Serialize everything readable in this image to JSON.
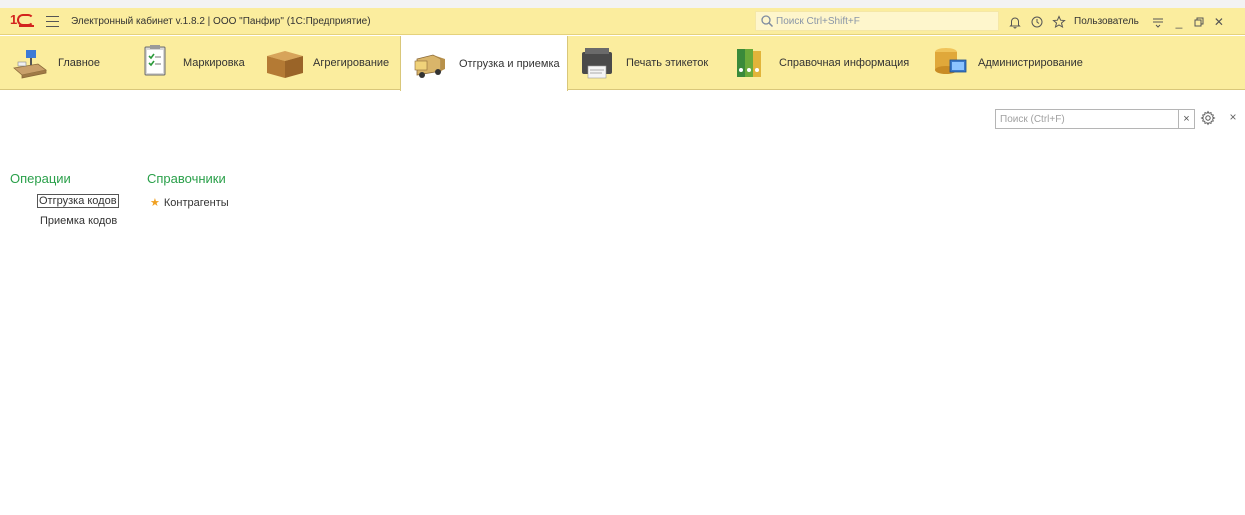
{
  "titlebar": {
    "title": "Электронный кабинет v.1.8.2 | ООО \"Панфир\" (1С:Предприятие)",
    "search_placeholder": "Поиск Ctrl+Shift+F",
    "user": "Пользователь"
  },
  "sections": [
    {
      "label": "Главное",
      "icon": "desk-icon"
    },
    {
      "label": "Маркировка",
      "icon": "checklist-icon"
    },
    {
      "label": "Агрегирование",
      "icon": "box-icon"
    },
    {
      "label": "Отгрузка и приемка",
      "icon": "truck-icon",
      "active": true
    },
    {
      "label": "Печать этикеток",
      "icon": "printer-icon"
    },
    {
      "label": "Справочная информация",
      "icon": "binders-icon"
    },
    {
      "label": "Администрирование",
      "icon": "database-icon"
    }
  ],
  "content": {
    "search_placeholder": "Поиск (Ctrl+F)",
    "clear_label": "×",
    "close_label": "×",
    "operations": {
      "title": "Операции",
      "items": [
        "Отгрузка кодов",
        "Приемка кодов"
      ]
    },
    "references": {
      "title": "Справочники",
      "items": [
        "Контрагенты"
      ]
    }
  },
  "colors": {
    "panel": "#fbed9e",
    "group_title": "#2aa04a",
    "logo": "#d3231e",
    "star": "#f0a020"
  }
}
